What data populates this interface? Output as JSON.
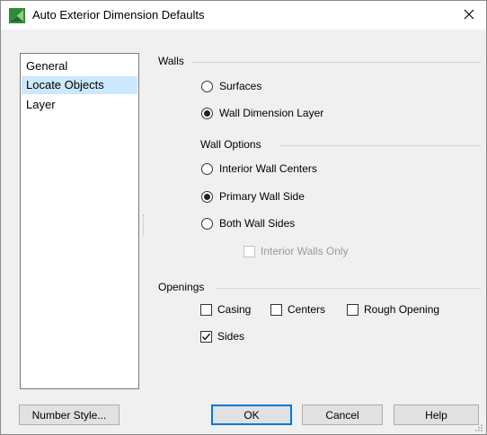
{
  "window": {
    "title": "Auto Exterior Dimension Defaults",
    "icon": "chief-architect-app-icon",
    "close_icon": "close-icon"
  },
  "nav": {
    "items": [
      {
        "label": "General",
        "selected": false
      },
      {
        "label": "Locate Objects",
        "selected": true
      },
      {
        "label": "Layer",
        "selected": false
      }
    ]
  },
  "walls": {
    "heading": "Walls",
    "options": [
      {
        "label": "Surfaces",
        "checked": false
      },
      {
        "label": "Wall Dimension Layer",
        "checked": true
      }
    ]
  },
  "wall_options": {
    "heading": "Wall Options",
    "options": [
      {
        "label": "Interior Wall Centers",
        "checked": false
      },
      {
        "label": "Primary Wall Side",
        "checked": true
      },
      {
        "label": "Both Wall Sides",
        "checked": false
      }
    ],
    "interior_only": {
      "label": "Interior Walls Only",
      "checked": false,
      "enabled": false
    }
  },
  "openings": {
    "heading": "Openings",
    "options": [
      {
        "label": "Casing",
        "checked": false
      },
      {
        "label": "Centers",
        "checked": false
      },
      {
        "label": "Rough Opening",
        "checked": false
      },
      {
        "label": "Sides",
        "checked": true
      }
    ]
  },
  "buttons": {
    "number_style": "Number Style...",
    "ok": "OK",
    "cancel": "Cancel",
    "help": "Help"
  },
  "colors": {
    "selection": "#cce8ff",
    "default_button_border": "#0078d7",
    "app_icon_green": "#3a9a3a"
  }
}
